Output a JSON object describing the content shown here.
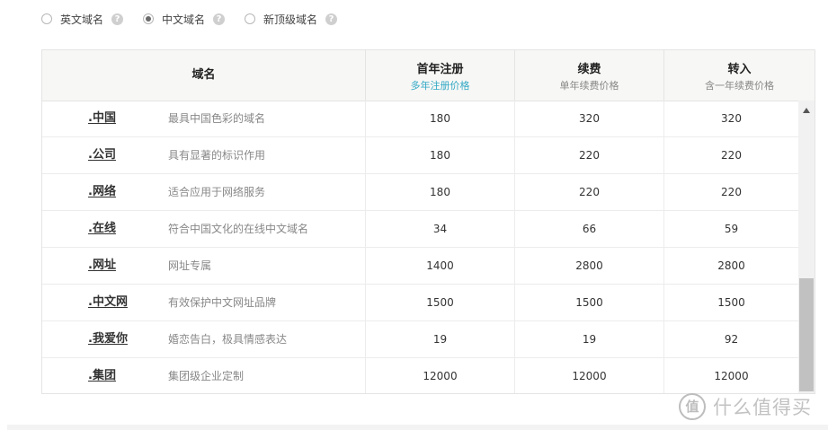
{
  "tabs": [
    {
      "label": "英文域名",
      "selected": false
    },
    {
      "label": "中文域名",
      "selected": true
    },
    {
      "label": "新顶级域名",
      "selected": false
    }
  ],
  "help_glyph": "?",
  "table": {
    "headers": {
      "name": "域名",
      "first_year": {
        "title": "首年注册",
        "sub": "多年注册价格"
      },
      "renew": {
        "title": "续费",
        "sub": "单年续费价格"
      },
      "transfer": {
        "title": "转入",
        "sub": "含一年续费价格"
      }
    },
    "rows": [
      {
        "domain": ".中国",
        "desc": "最具中国色彩的域名",
        "first_year": "180",
        "renew": "320",
        "transfer": "320"
      },
      {
        "domain": ".公司",
        "desc": "具有显著的标识作用",
        "first_year": "180",
        "renew": "220",
        "transfer": "220"
      },
      {
        "domain": ".网络",
        "desc": "适合应用于网络服务",
        "first_year": "180",
        "renew": "220",
        "transfer": "220"
      },
      {
        "domain": ".在线",
        "desc": "符合中国文化的在线中文域名",
        "first_year": "34",
        "renew": "66",
        "transfer": "59"
      },
      {
        "domain": ".网址",
        "desc": "网址专属",
        "first_year": "1400",
        "renew": "2800",
        "transfer": "2800"
      },
      {
        "domain": ".中文网",
        "desc": "有效保护中文网址品牌",
        "first_year": "1500",
        "renew": "1500",
        "transfer": "1500"
      },
      {
        "domain": ".我爱你",
        "desc": "婚恋告白，极具情感表达",
        "first_year": "19",
        "renew": "19",
        "transfer": "92"
      },
      {
        "domain": ".集团",
        "desc": "集团级企业定制",
        "first_year": "12000",
        "renew": "12000",
        "transfer": "12000"
      }
    ]
  },
  "watermark": {
    "logo_glyph": "值",
    "text": "什么值得买"
  },
  "colors": {
    "accent": "#33a9c6",
    "header_bg": "#f7f7f5",
    "border": "#e4e4e4"
  }
}
